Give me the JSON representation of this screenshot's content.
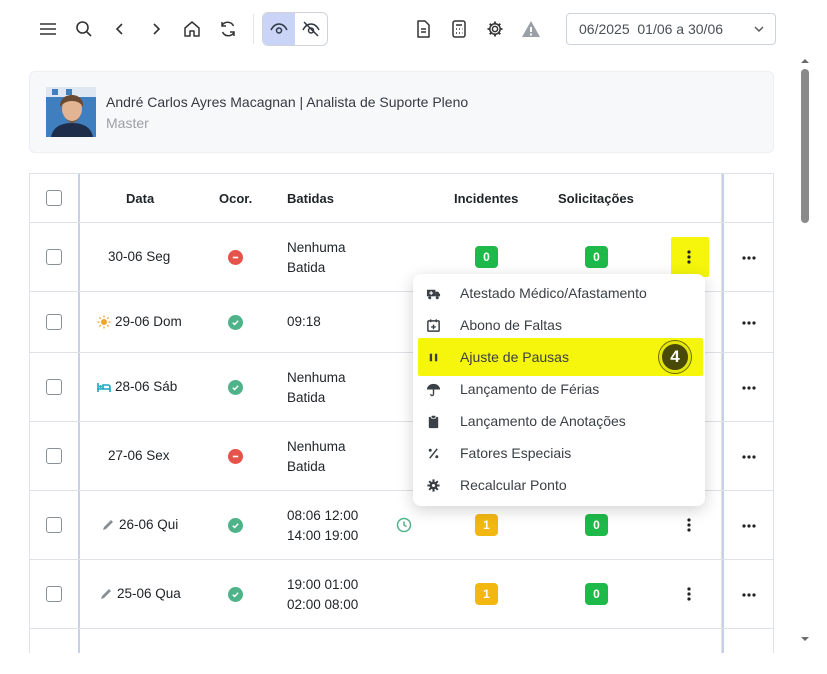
{
  "toolbar": {
    "icons": [
      "menu-icon",
      "search-icon",
      "chevron-left-icon",
      "chevron-right-icon",
      "home-icon",
      "refresh-icon",
      "eye-icon",
      "eye-off-icon",
      "document-icon",
      "calculator-icon",
      "gear-icon",
      "warning-icon"
    ],
    "period": "06/2025  01/06 a 30/06"
  },
  "profile": {
    "name": "André Carlos Ayres Macagnan | Analista de Suporte Pleno",
    "role": "Master"
  },
  "table": {
    "headers": {
      "data": "Data",
      "ocor": "Ocor.",
      "batidas": "Batidas",
      "incidentes": "Incidentes",
      "solicitacoes": "Solicitações"
    },
    "rows": [
      {
        "date": "30-06 Seg",
        "date_icon": "",
        "status": "error",
        "punch1": "Nenhuma",
        "punch2": "Batida",
        "incidentes": "0",
        "solicitacoes": "0"
      },
      {
        "date": "29-06 Dom",
        "date_icon": "sun-icon",
        "status": "ok",
        "punch1": "09:18",
        "punch2": "",
        "incidentes": "",
        "solicitacoes": ""
      },
      {
        "date": "28-06 Sáb",
        "date_icon": "bed-icon",
        "status": "ok",
        "punch1": "Nenhuma",
        "punch2": "Batida",
        "incidentes": "",
        "solicitacoes": ""
      },
      {
        "date": "27-06 Sex",
        "date_icon": "",
        "status": "error",
        "punch1": "Nenhuma",
        "punch2": "Batida",
        "incidentes": "",
        "solicitacoes": ""
      },
      {
        "date": "26-06 Qui",
        "date_icon": "pencil-icon",
        "status": "ok",
        "punch1": "08:06 12:00",
        "punch2": "14:00 19:00",
        "incidentes": "1",
        "solicitacoes": "0"
      },
      {
        "date": "25-06 Qua",
        "date_icon": "pencil-icon",
        "status": "ok",
        "punch1": "19:00 01:00",
        "punch2": "02:00 08:00",
        "incidentes": "1",
        "solicitacoes": "0"
      }
    ]
  },
  "menu": {
    "items": [
      {
        "label": "Atestado Médico/Afastamento",
        "icon": "ambulance-icon"
      },
      {
        "label": "Abono de Faltas",
        "icon": "calendar-plus-icon"
      },
      {
        "label": "Ajuste de Pausas",
        "icon": "pause-icon"
      },
      {
        "label": "Lançamento de Férias",
        "icon": "umbrella-icon"
      },
      {
        "label": "Lançamento de Anotações",
        "icon": "clipboard-icon"
      },
      {
        "label": "Fatores Especiais",
        "icon": "percent-icon"
      },
      {
        "label": "Recalcular Ponto",
        "icon": "gear-icon"
      }
    ],
    "step_number": "4"
  },
  "colors": {
    "highlight": "#f5f60c",
    "badge_green": "#1fb94a",
    "badge_yellow": "#f2b811",
    "status_error": "#e5534b",
    "status_ok": "#4fb38a"
  }
}
